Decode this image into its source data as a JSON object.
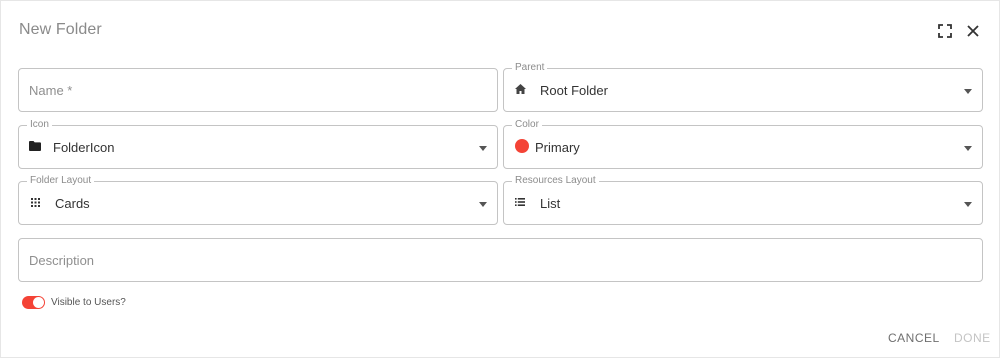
{
  "dialog": {
    "title": "New Folder",
    "expand_icon": "fullscreen-icon",
    "close_icon": "close-icon"
  },
  "fields": {
    "name": {
      "placeholder": "Name *",
      "value": ""
    },
    "parent": {
      "label": "Parent",
      "value": "Root Folder",
      "icon": "home-icon"
    },
    "icon": {
      "label": "Icon",
      "value": "FolderIcon",
      "icon": "folder-icon"
    },
    "color": {
      "label": "Color",
      "value": "Primary",
      "swatch": "#f44336"
    },
    "folder_layout": {
      "label": "Folder Layout",
      "value": "Cards",
      "icon": "grid-icon"
    },
    "resources_layout": {
      "label": "Resources Layout",
      "value": "List",
      "icon": "list-icon"
    },
    "description": {
      "placeholder": "Description",
      "value": ""
    }
  },
  "visibility": {
    "label": "Visible to Users?",
    "checked": true,
    "color": "#f44336"
  },
  "actions": {
    "cancel_label": "CANCEL",
    "done_label": "DONE"
  }
}
